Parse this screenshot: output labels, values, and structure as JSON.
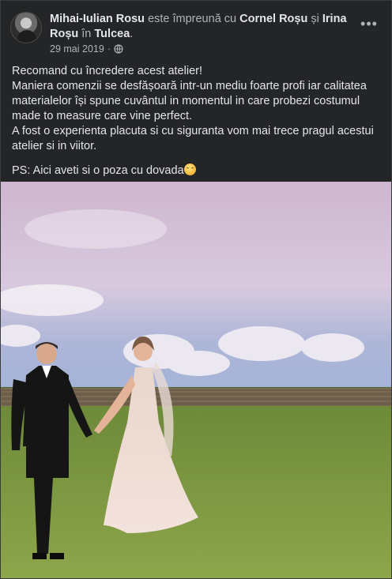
{
  "post": {
    "author": "Mihai-Iulian Rosu",
    "with_text": "este împreună cu",
    "tag1": "Cornel Roșu",
    "and_text": "și",
    "tag2": "Irina Roșu",
    "in_text": "în",
    "location": "Tulcea",
    "period": ".",
    "date": "29 mai 2019",
    "dot": "·",
    "privacy_icon": "globe-icon",
    "more_icon": "more-options-icon",
    "lines": [
      "Recomand cu încredere acest atelier!",
      "Maniera comenzii se desfășoară intr-un mediu foarte profi iar calitatea materialelor își spune cuvântul in momentul in care probezi costumul made to measure care vine perfect.",
      "A fost o experienta placuta si cu siguranta vom mai trece pragul acestui atelier si in viitor."
    ],
    "ps": "PS: Aici aveti si o poza cu dovada",
    "emoji": "smiling-face-icon"
  },
  "colors": {
    "card_bg": "#242526",
    "text_primary": "#e4e6eb",
    "text_secondary": "#b0b3b8"
  }
}
